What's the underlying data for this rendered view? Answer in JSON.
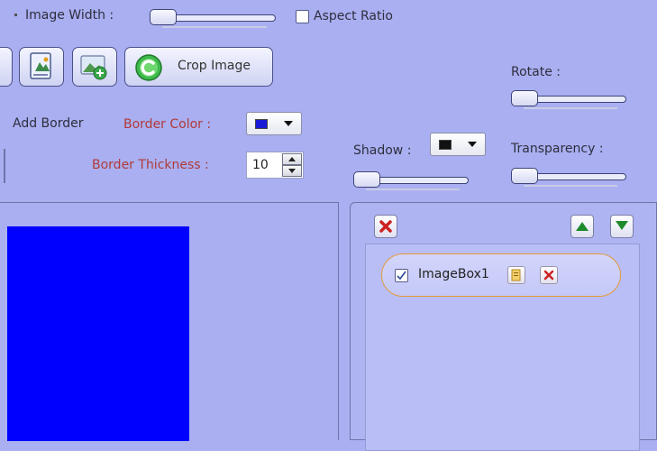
{
  "toolbar": {
    "image_width_label": "Image Width :",
    "aspect_ratio_label": "Aspect Ratio",
    "aspect_ratio_checked": false,
    "crop_image_label": "Crop Image"
  },
  "border": {
    "add_border_label": "Add Border",
    "border_color_label": "Border Color :",
    "border_color_value": "#1a1ad6",
    "border_thickness_label": "Border Thickness :",
    "border_thickness_value": "10"
  },
  "effects": {
    "rotate_label": "Rotate :",
    "shadow_label": "Shadow :",
    "shadow_color_value": "#111111",
    "transparency_label": "Transparency :"
  },
  "layers": {
    "items": [
      {
        "label": "ImageBox1",
        "checked": true
      }
    ]
  },
  "colors": {
    "background": "#a9aff0",
    "canvas_image": "#0000ff",
    "label_red": "#b03a3a",
    "pill_border": "#e39a3a"
  }
}
